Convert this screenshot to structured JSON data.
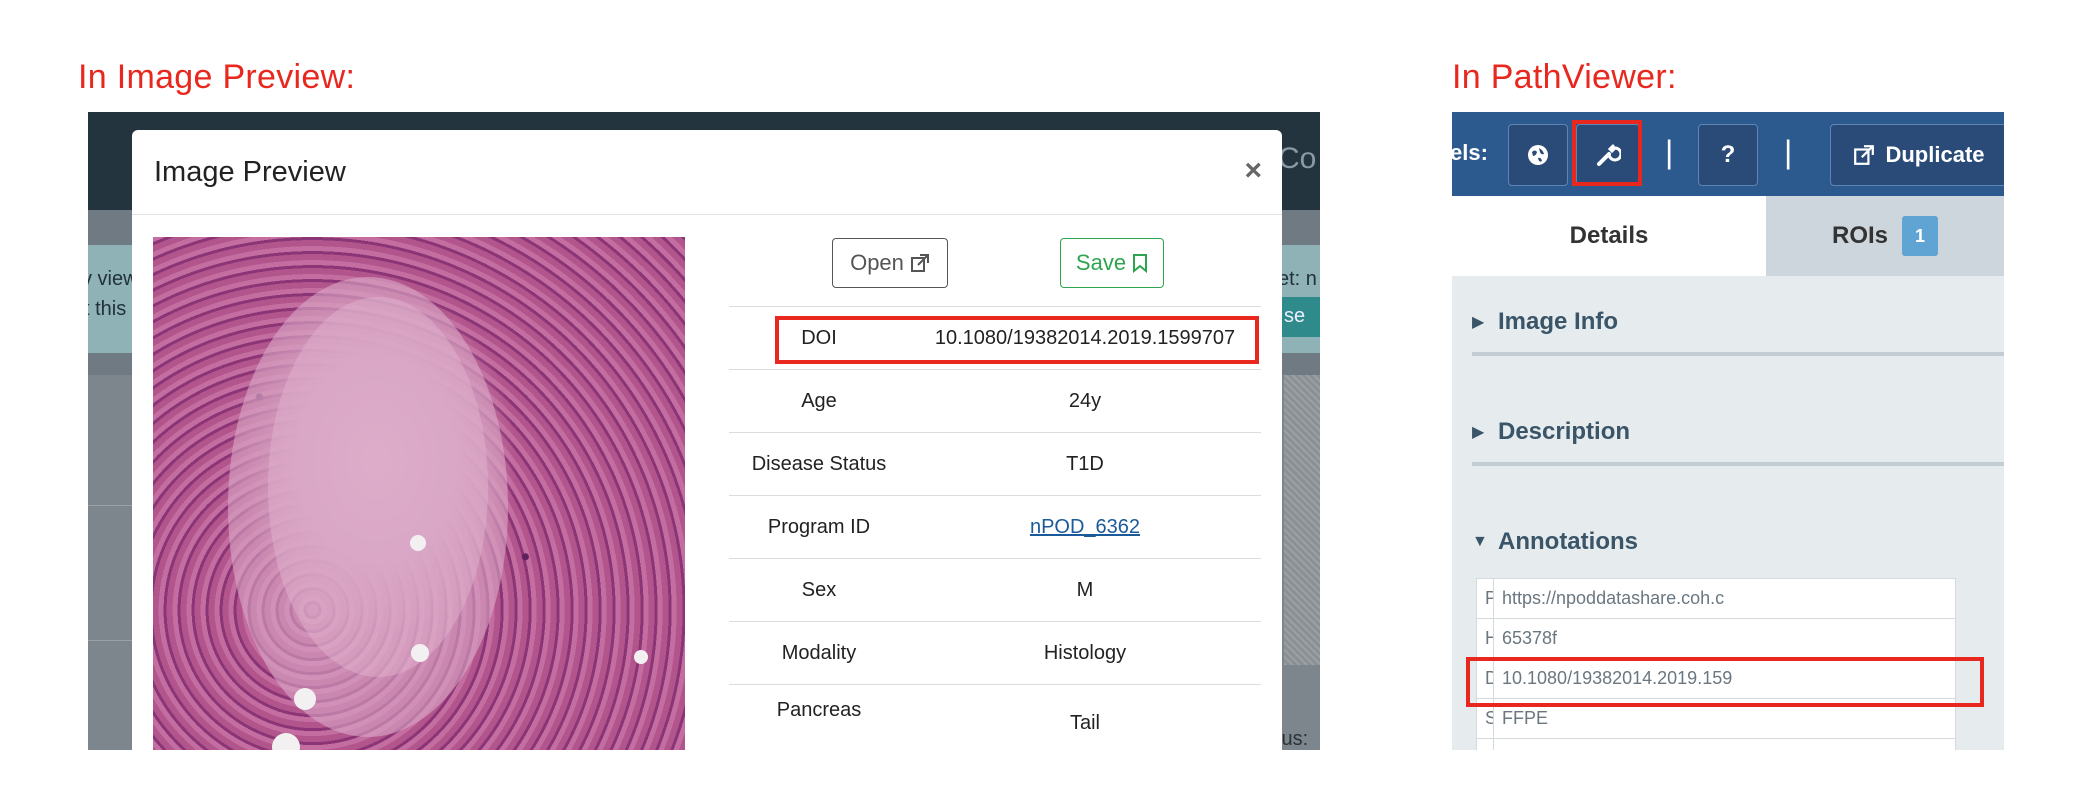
{
  "captions": {
    "left": "In Image Preview:",
    "right": "In PathViewer:"
  },
  "background_page": {
    "header_fragment": "Co",
    "banner_line1_left": "v view",
    "banner_line2_left": "t this",
    "banner_line1_right": "et: n",
    "banner_button_fragment": "se",
    "status_fragment": "tus: T"
  },
  "image_preview": {
    "title": "Image Preview",
    "close_glyph": "×",
    "open_label": "Open",
    "save_label": "Save",
    "rows": [
      {
        "label": "DOI",
        "value": "10.1080/19382014.2019.1599707"
      },
      {
        "label": "Age",
        "value": "24y"
      },
      {
        "label": "Disease Status",
        "value": "T1D"
      },
      {
        "label": "Program ID",
        "value": "nPOD_6362",
        "link": true
      },
      {
        "label": "Sex",
        "value": "M"
      },
      {
        "label": "Modality",
        "value": "Histology"
      },
      {
        "label": "Pancreas",
        "value": "Tail"
      }
    ]
  },
  "pathviewer": {
    "toolbar_label": "els:",
    "duplicate_label": "Duplicate",
    "help_label": "?",
    "separator": "|",
    "tabs": {
      "details": "Details",
      "rois": "ROIs",
      "rois_count": "1"
    },
    "sections": {
      "image_info": "Image Info",
      "description": "Description",
      "annotations": "Annotations"
    },
    "annotations": [
      {
        "key": "Program ID link",
        "value": "https://npoddatashare.coh.c"
      },
      {
        "key": "Hex code - H&E",
        "value": "65378f"
      },
      {
        "key": "DOI",
        "value": "10.1080/19382014.2019.159"
      },
      {
        "key": "Sample info - Processing Ty",
        "value": "FFPE"
      },
      {
        "key": "",
        "value": ""
      }
    ]
  },
  "colors": {
    "annotation_red": "#e8281f",
    "save_green": "#2ea44f",
    "pv_toolbar": "#2c5a8f",
    "pv_badge": "#5fa4d3"
  }
}
